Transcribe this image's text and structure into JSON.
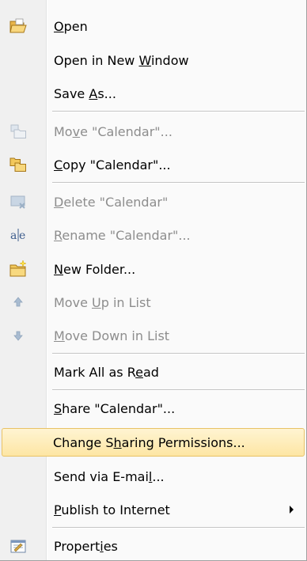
{
  "menu": {
    "items": [
      {
        "id": "open",
        "pre": "",
        "key": "O",
        "post": "pen",
        "disabled": false,
        "icon": "folder-open-icon"
      },
      {
        "id": "open-new-window",
        "pre": "Open in New ",
        "key": "W",
        "post": "indow",
        "disabled": false,
        "icon": ""
      },
      {
        "id": "save-as",
        "pre": "Save ",
        "key": "A",
        "post": "s...",
        "disabled": false,
        "icon": ""
      },
      {
        "id": "move",
        "pre": "Mo",
        "key": "v",
        "post": "e \"Calendar\"...",
        "disabled": true,
        "icon": "move-icon"
      },
      {
        "id": "copy",
        "pre": "",
        "key": "C",
        "post": "opy \"Calendar\"...",
        "disabled": false,
        "icon": "copy-folder-icon"
      },
      {
        "id": "delete",
        "pre": "",
        "key": "D",
        "post": "elete \"Calendar\"",
        "disabled": true,
        "icon": "delete-folder-icon"
      },
      {
        "id": "rename",
        "pre": "",
        "key": "R",
        "post": "ename \"Calendar\"...",
        "disabled": true,
        "icon": "rename-icon"
      },
      {
        "id": "new-folder",
        "pre": "",
        "key": "N",
        "post": "ew Folder...",
        "disabled": false,
        "icon": "new-folder-icon"
      },
      {
        "id": "move-up",
        "pre": "Move ",
        "key": "U",
        "post": "p in List",
        "disabled": true,
        "icon": "arrow-up-icon"
      },
      {
        "id": "move-down",
        "pre": "",
        "key": "M",
        "post": "ove Down in List",
        "disabled": true,
        "icon": "arrow-down-icon"
      },
      {
        "id": "mark-all-read",
        "pre": "Mark All as R",
        "key": "e",
        "post": "ad",
        "disabled": false,
        "icon": ""
      },
      {
        "id": "share",
        "pre": "",
        "key": "S",
        "post": "hare \"Calendar\"...",
        "disabled": false,
        "icon": ""
      },
      {
        "id": "change-sharing",
        "pre": "Change S",
        "key": "h",
        "post": "aring Permissions...",
        "disabled": false,
        "icon": "",
        "highlight": true
      },
      {
        "id": "send-email",
        "pre": "Send via E-mai",
        "key": "l",
        "post": "...",
        "disabled": false,
        "icon": ""
      },
      {
        "id": "publish",
        "pre": "",
        "key": "P",
        "post": "ublish to Internet",
        "disabled": false,
        "icon": "",
        "submenu": true
      },
      {
        "id": "properties",
        "pre": "Propert",
        "key": "i",
        "post": "es",
        "disabled": false,
        "icon": "properties-icon"
      }
    ]
  }
}
